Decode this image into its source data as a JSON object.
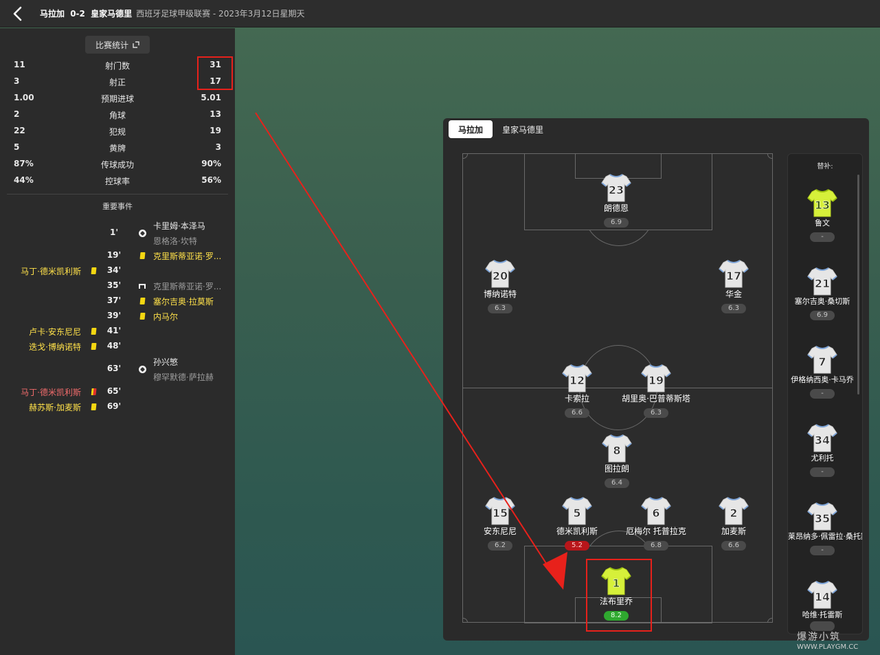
{
  "header": {
    "home_team": "马拉加",
    "score": "0-2",
    "away_team": "皇家马德里",
    "subtitle": "西班牙足球甲级联赛 - 2023年3月12日星期天"
  },
  "stats": {
    "button_label": "比赛统计",
    "rows": [
      {
        "home": "11",
        "label": "射门数",
        "away": "31"
      },
      {
        "home": "3",
        "label": "射正",
        "away": "17"
      },
      {
        "home": "1.00",
        "label": "预期进球",
        "away": "5.01"
      },
      {
        "home": "2",
        "label": "角球",
        "away": "13"
      },
      {
        "home": "22",
        "label": "犯规",
        "away": "19"
      },
      {
        "home": "5",
        "label": "黄牌",
        "away": "3"
      },
      {
        "home": "87%",
        "label": "传球成功",
        "away": "90%"
      },
      {
        "home": "44%",
        "label": "控球率",
        "away": "56%"
      }
    ]
  },
  "events": {
    "title": "重要事件",
    "items": [
      {
        "minute": "1'",
        "side": "away",
        "type": "goal",
        "name": "卡里姆·本泽马",
        "sub_name": "恩格洛·坎特"
      },
      {
        "minute": "19'",
        "side": "away",
        "type": "yellow",
        "name": "克里斯蒂亚诺·罗..."
      },
      {
        "minute": "34'",
        "side": "home",
        "type": "yellow",
        "name": "马丁·德米凯利斯"
      },
      {
        "minute": "35'",
        "side": "away",
        "type": "sub",
        "name": "克里斯蒂亚诺·罗..."
      },
      {
        "minute": "37'",
        "side": "away",
        "type": "yellow",
        "name": "塞尔吉奥·拉莫斯"
      },
      {
        "minute": "39'",
        "side": "away",
        "type": "yellow",
        "name": "内马尔"
      },
      {
        "minute": "41'",
        "side": "home",
        "type": "yellow",
        "name": "卢卡·安东尼尼"
      },
      {
        "minute": "48'",
        "side": "home",
        "type": "yellow",
        "name": "迭戈·博纳诺特"
      },
      {
        "minute": "63'",
        "side": "away",
        "type": "goal",
        "name": "孙兴慜",
        "sub_name": "穆罕默德·萨拉赫"
      },
      {
        "minute": "65'",
        "side": "home",
        "type": "red",
        "name": "马丁·德米凯利斯"
      },
      {
        "minute": "69'",
        "side": "home",
        "type": "yellow",
        "name": "赫苏斯·加麦斯"
      }
    ]
  },
  "lineup": {
    "tab_home": "马拉加",
    "tab_away": "皇家马德里",
    "players": [
      {
        "number": "23",
        "name": "朗德恩",
        "rating": "6.9",
        "rating_style": "normal",
        "kit": "white"
      },
      {
        "number": "20",
        "name": "博纳诺特",
        "rating": "6.3",
        "rating_style": "normal",
        "kit": "white"
      },
      {
        "number": "17",
        "name": "华金",
        "rating": "6.3",
        "rating_style": "normal",
        "kit": "white"
      },
      {
        "number": "12",
        "name": "卡索拉",
        "rating": "6.6",
        "rating_style": "normal",
        "kit": "white"
      },
      {
        "number": "19",
        "name": "胡里奥·巴普蒂斯塔",
        "rating": "6.3",
        "rating_style": "normal",
        "kit": "white"
      },
      {
        "number": "8",
        "name": "图拉朗",
        "rating": "6.4",
        "rating_style": "normal",
        "kit": "white"
      },
      {
        "number": "15",
        "name": "安东尼尼",
        "rating": "6.2",
        "rating_style": "normal",
        "kit": "white"
      },
      {
        "number": "5",
        "name": "德米凯利斯",
        "rating": "5.2",
        "rating_style": "red",
        "kit": "white"
      },
      {
        "number": "6",
        "name": "厄梅尔 托普拉克",
        "rating": "6.8",
        "rating_style": "normal",
        "kit": "white"
      },
      {
        "number": "2",
        "name": "加麦斯",
        "rating": "6.6",
        "rating_style": "normal",
        "kit": "white"
      },
      {
        "number": "1",
        "name": "法布里乔",
        "rating": "8.2",
        "rating_style": "green",
        "kit": "yellow"
      }
    ],
    "subs_title": "替补:",
    "subs": [
      {
        "number": "13",
        "name": "鲁文",
        "rating": "-",
        "kit": "yellow"
      },
      {
        "number": "21",
        "name": "塞尔吉奥·桑切斯",
        "rating": "6.9",
        "kit": "white"
      },
      {
        "number": "7",
        "name": "伊格纳西奥·卡马乔",
        "rating": "-",
        "kit": "white"
      },
      {
        "number": "34",
        "name": "尤利托",
        "rating": "-",
        "kit": "white"
      },
      {
        "number": "35",
        "name": "莱昂纳多·佩雷拉·桑托斯",
        "rating": "-",
        "kit": "white"
      },
      {
        "number": "14",
        "name": "哈维·托雷斯",
        "rating": "",
        "kit": "white"
      }
    ]
  },
  "watermark": {
    "brand": "爆游小筑",
    "url": "WWW.PLAYGM.CC"
  },
  "colors": {
    "yellow_name": "#ffe14a",
    "red_name": "#f06b6b",
    "highlight": "#e8211b",
    "rating_green": "#2fa82f",
    "rating_red": "#b8161a"
  }
}
